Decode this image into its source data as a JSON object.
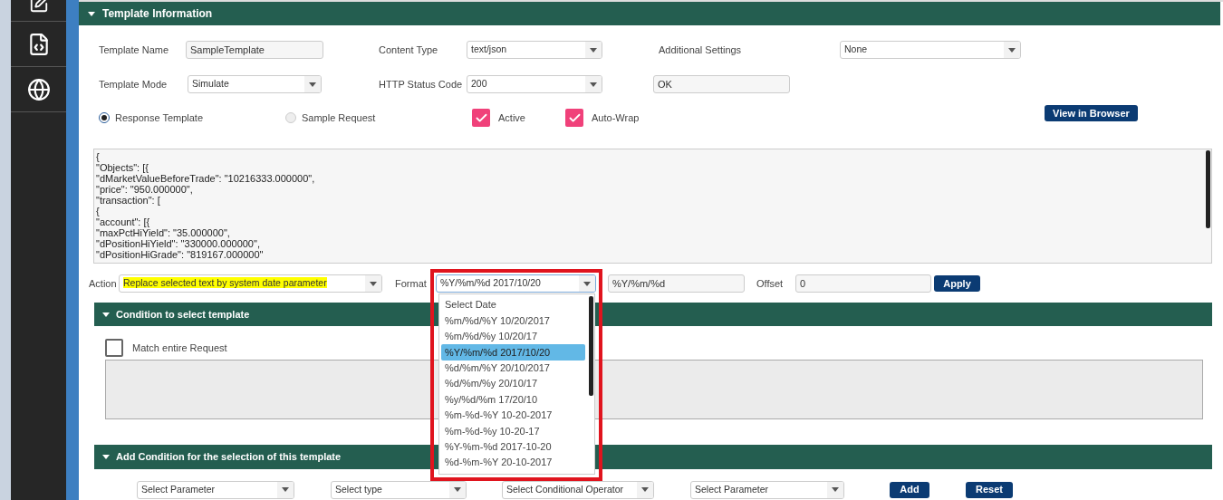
{
  "template_information": {
    "title": "Template Information",
    "expanded": true,
    "rows": [
      [
        {
          "kind": "label",
          "text": "Template Name"
        },
        {
          "kind": "input",
          "value": "SampleTemplate"
        },
        {
          "kind": "label",
          "text": "Content Type"
        },
        {
          "kind": "select",
          "value": "text/json"
        },
        {
          "kind": "label",
          "text": "Additional Settings"
        },
        {
          "kind": "select",
          "value": "None"
        }
      ],
      [
        {
          "kind": "label",
          "text": "Template Mode"
        },
        {
          "kind": "select",
          "value": "Simulate"
        },
        {
          "kind": "label",
          "text": "HTTP Status Code"
        },
        {
          "kind": "select",
          "value": "200"
        },
        {
          "kind": "input",
          "value": "OK"
        }
      ]
    ],
    "template_type": [
      {
        "label": "Response Template",
        "selected": true
      },
      {
        "label": "Sample Request",
        "selected": false
      }
    ],
    "options": [
      {
        "label": "Active",
        "checked": true
      },
      {
        "label": "Auto-Wrap",
        "checked": true
      }
    ],
    "view_button": "View in Browser",
    "template_text": [
      "{",
      "\"Objects\": [{",
      "\"dMarketValueBeforeTrade\": \"10216333.000000\",",
      "\"price\": \"950.000000\",",
      "\"transaction\": [",
      "{",
      "\"account\": [{",
      "\"maxPctHiYield\": \"35.000000\",",
      "\"dPositionHiYield\": \"330000.000000\",",
      "\"dPositionHiGrade\": \"819167.000000\""
    ],
    "action": {
      "label": "Action",
      "value": "Replace selected text by system date parameter",
      "highlighted": true
    },
    "format": {
      "label": "Format",
      "value": "%Y/%m/%d 2017/10/20",
      "expanded": true,
      "options": [
        {
          "label": "Select Date",
          "selected": false
        },
        {
          "label": "%m/%d/%Y 10/20/2017",
          "selected": false
        },
        {
          "label": "%m/%d/%y 10/20/17",
          "selected": false
        },
        {
          "label": "%Y/%m/%d 2017/10/20",
          "selected": true
        },
        {
          "label": "%d/%m/%Y 20/10/2017",
          "selected": false
        },
        {
          "label": "%d/%m/%y 20/10/17",
          "selected": false
        },
        {
          "label": "%y/%d/%m 17/20/10",
          "selected": false
        },
        {
          "label": "%m-%d-%Y 10-20-2017",
          "selected": false
        },
        {
          "label": "%m-%d-%y 10-20-17",
          "selected": false
        },
        {
          "label": "%Y-%m-%d 2017-10-20",
          "selected": false
        },
        {
          "label": "%d-%m-%Y 20-10-2017",
          "selected": false
        }
      ]
    },
    "format_pattern": "%Y/%m/%d",
    "offset": {
      "label": "Offset",
      "value": "0"
    },
    "apply_button": "Apply"
  },
  "condition_section": {
    "title": "Condition to select template",
    "expanded": true,
    "match_entire": {
      "label": "Match entire Request",
      "checked": false
    }
  },
  "add_condition_section": {
    "title": "Add Condition for the selection of this template",
    "expanded": true,
    "selects": [
      "Select Parameter",
      "Select type",
      "Select Conditional Operator",
      "Select Parameter"
    ],
    "buttons": [
      "Add",
      "Reset"
    ]
  }
}
